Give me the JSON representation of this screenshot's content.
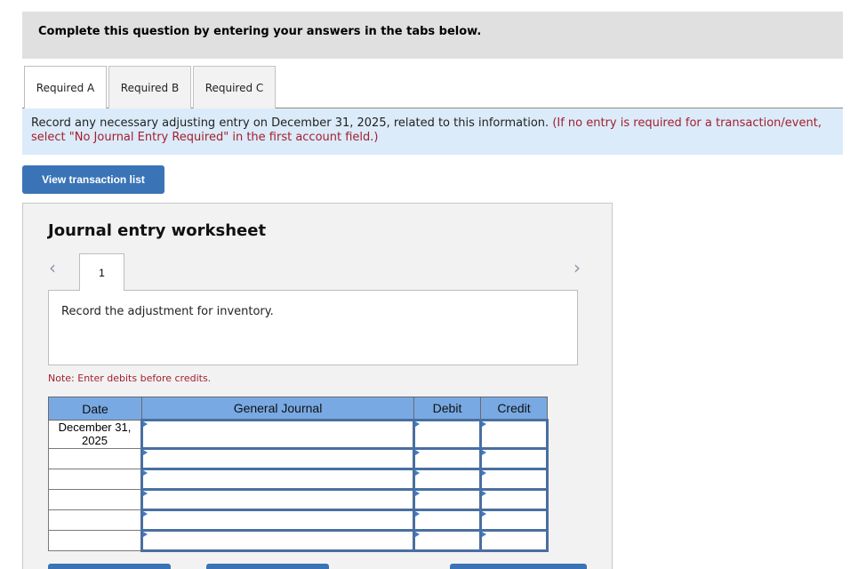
{
  "instruction": "Complete this question by entering your answers in the tabs below.",
  "tabs": [
    {
      "label": "Required A",
      "active": true
    },
    {
      "label": "Required B",
      "active": false
    },
    {
      "label": "Required C",
      "active": false
    }
  ],
  "prompt": {
    "text": "Record any necessary adjusting entry on December 31, 2025, related to this information.",
    "hint": "(If no entry is required for a transaction/event, select \"No Journal Entry Required\" in the first account field.)"
  },
  "view_transactions_label": "View transaction list",
  "worksheet": {
    "title": "Journal entry worksheet",
    "prev_icon": "chevron-left-icon",
    "next_icon": "chevron-right-icon",
    "prev_glyph": "‹",
    "next_glyph": "›",
    "entry_number": "1",
    "entry_description": "Record the adjustment for inventory.",
    "note": "Note: Enter debits before credits.",
    "table": {
      "headers": [
        "Date",
        "General Journal",
        "Debit",
        "Credit"
      ],
      "rows": [
        {
          "date": "December 31, 2025",
          "account": "",
          "debit": "",
          "credit": ""
        },
        {
          "date": "",
          "account": "",
          "debit": "",
          "credit": ""
        },
        {
          "date": "",
          "account": "",
          "debit": "",
          "credit": ""
        },
        {
          "date": "",
          "account": "",
          "debit": "",
          "credit": ""
        },
        {
          "date": "",
          "account": "",
          "debit": "",
          "credit": ""
        },
        {
          "date": "",
          "account": "",
          "debit": "",
          "credit": ""
        }
      ]
    }
  },
  "colors": {
    "accent": "#3a74b6",
    "header_blue": "#78a9e3",
    "hint_red": "#a51e2e",
    "prompt_bg": "#dbebf9"
  }
}
